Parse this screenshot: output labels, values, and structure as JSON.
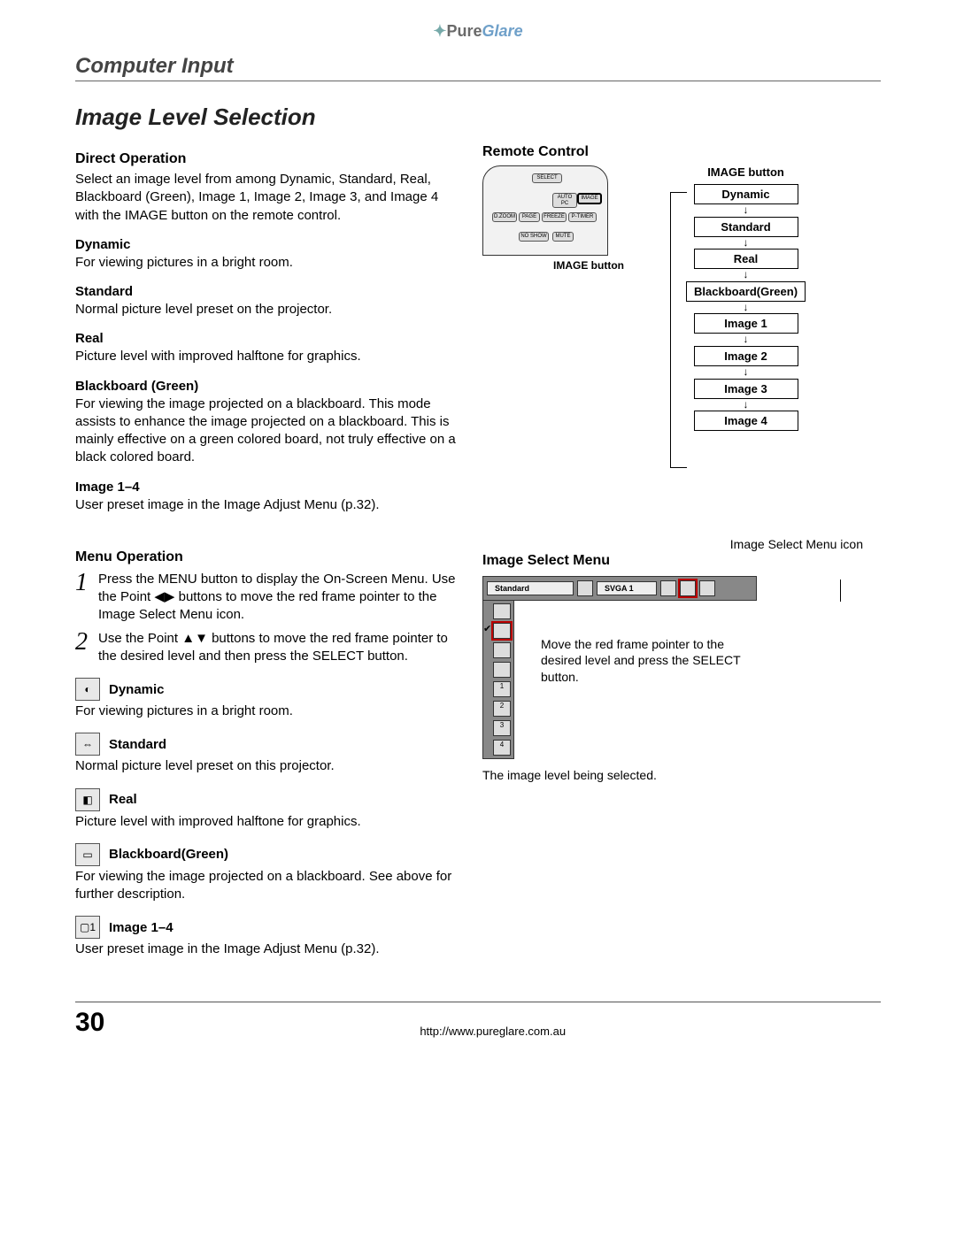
{
  "logo": {
    "icon": "✦",
    "pure": "Pure",
    "glare": "Glare"
  },
  "section": "Computer Input",
  "title": "Image Level Selection",
  "direct_op": {
    "heading": "Direct Operation",
    "intro": "Select an image level from among Dynamic, Standard, Real, Blackboard (Green), Image 1, Image 2, Image 3, and Image 4 with the IMAGE button on the remote control.",
    "items": [
      {
        "name": "Dynamic",
        "desc": "For viewing pictures in a bright room."
      },
      {
        "name": "Standard",
        "desc": "Normal picture level preset on the projector."
      },
      {
        "name": "Real",
        "desc": "Picture level with improved halftone for graphics."
      },
      {
        "name": "Blackboard (Green)",
        "desc": "For viewing the image projected on a blackboard. This mode assists to enhance the image projected on a blackboard. This is mainly effective on a green colored board, not truly effective on a black colored board."
      },
      {
        "name": "Image 1–4",
        "desc": "User preset image in the Image Adjust Menu (p.32)."
      }
    ]
  },
  "menu_op": {
    "heading": "Menu Operation",
    "steps": [
      {
        "num": "1",
        "text": "Press the MENU button to display the On-Screen Menu. Use the Point ◀▶ buttons to move the red frame pointer to the Image Select Menu icon."
      },
      {
        "num": "2",
        "text": "Use the Point ▲▼ buttons to move the red frame pointer to the desired level and then press the SELECT button."
      }
    ],
    "icons": [
      {
        "glyph": "◐",
        "title": "Dynamic",
        "desc": "For viewing pictures in a bright room."
      },
      {
        "glyph": "⇔",
        "title": "Standard",
        "desc": "Normal picture level preset on this projector."
      },
      {
        "glyph": "◧",
        "title": "Real",
        "desc": "Picture level with improved halftone for graphics."
      },
      {
        "glyph": "▭",
        "title": "Blackboard(Green)",
        "desc": "For viewing the image projected on a blackboard. See above for further description."
      },
      {
        "glyph": "▢1",
        "title": "Image 1–4",
        "desc": "User preset image in the Image Adjust Menu (p.32)."
      }
    ]
  },
  "remote": {
    "heading": "Remote Control",
    "caption": "IMAGE button",
    "flow_title": "IMAGE button",
    "flow": [
      "Dynamic",
      "Standard",
      "Real",
      "Blackboard(Green)",
      "Image 1",
      "Image 2",
      "Image 3",
      "Image 4"
    ],
    "remote_buttons": [
      "SELECT",
      "AUTO PC",
      "IMAGE",
      "D.ZOOM",
      "PAGE",
      "FREEZE",
      "P-TIMER",
      "NO SHOW",
      "MUTE"
    ]
  },
  "image_select": {
    "icon_label": "Image Select Menu icon",
    "heading": "Image Select Menu",
    "bar_label": "Standard",
    "bar_mode": "SVGA 1",
    "callout": "Move the red frame pointer to the desired level and press the SELECT button.",
    "caption": "The image level being selected."
  },
  "footer": {
    "page": "30",
    "url": "http://www.pureglare.com.au"
  }
}
